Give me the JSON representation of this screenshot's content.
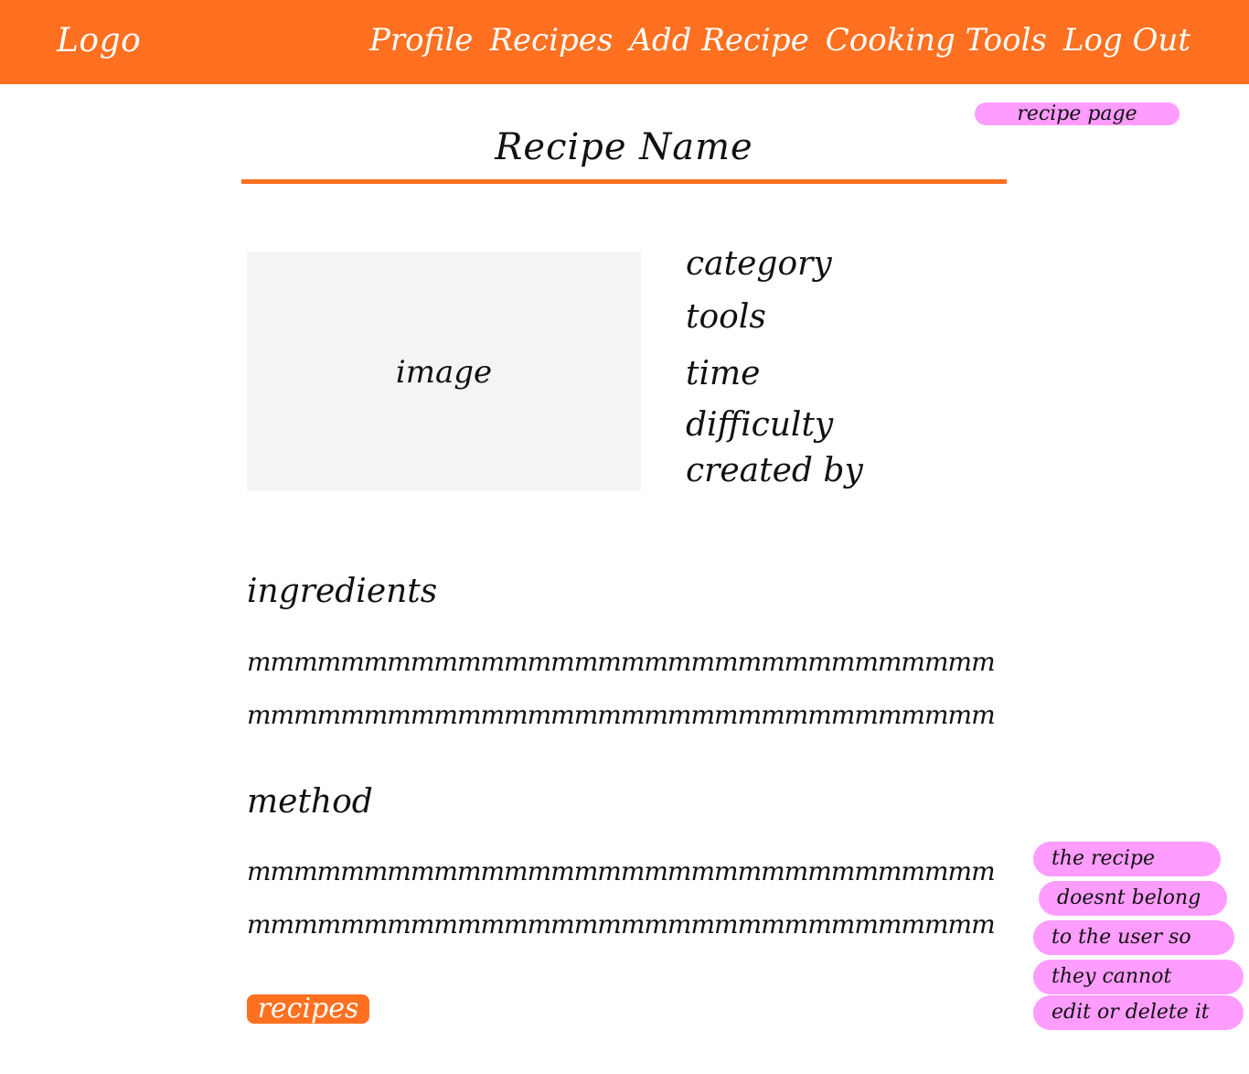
{
  "nav": {
    "logo": "Logo",
    "links": [
      "Profile",
      "Recipes",
      "Add Recipe",
      "Cooking Tools",
      "Log Out"
    ]
  },
  "annotations": {
    "page_label": "recipe page",
    "ownership_note": [
      "the recipe",
      "doesnt belong",
      "to the user so",
      "they cannot",
      "edit or delete it"
    ]
  },
  "recipe": {
    "title": "Recipe Name",
    "image_label": "image",
    "meta": [
      "category",
      "tools",
      "time",
      "difficulty",
      "created by"
    ],
    "ingredients": {
      "heading": "ingredients",
      "lines": [
        "mmmmmmmmmmmmmmmmmmmmmmmmmmmmmmmm",
        "mmmmmmmmmmmmmmmmmmmmmmmmmmmmmmmm"
      ]
    },
    "method": {
      "heading": "method",
      "lines": [
        "mmmmmmmmmmmmmmmmmmmmmmmmmmmmmmmm",
        "mmmmmmmmmmmmmmmmmmmmmmmmmmmmmmmm"
      ]
    },
    "back_button": "recipes"
  },
  "colors": {
    "brand_orange": "#ff7020",
    "note_pink": "#ff9cff",
    "image_placeholder": "#f4f4f4"
  }
}
